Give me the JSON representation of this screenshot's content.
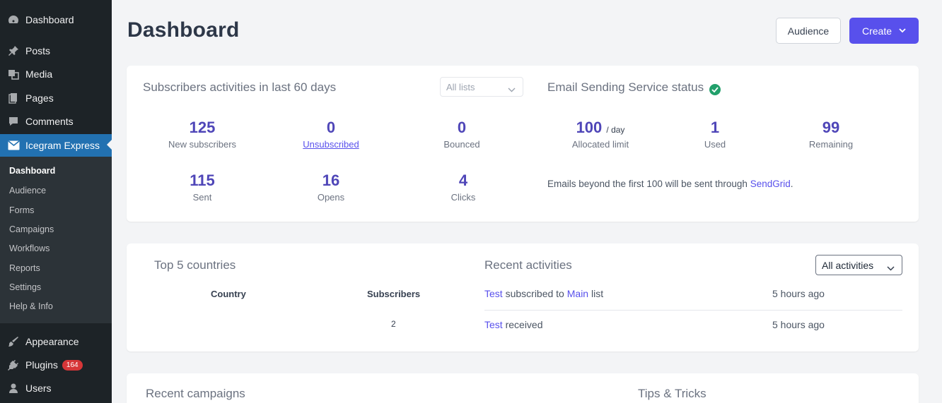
{
  "sidebar": {
    "items": [
      {
        "label": "Dashboard",
        "icon": "gauge-icon"
      },
      {
        "label": "Posts",
        "icon": "pin-icon"
      },
      {
        "label": "Media",
        "icon": "media-icon"
      },
      {
        "label": "Pages",
        "icon": "pages-icon"
      },
      {
        "label": "Comments",
        "icon": "comment-icon"
      },
      {
        "label": "Icegram Express",
        "icon": "envelope-icon"
      }
    ],
    "submenu": [
      "Dashboard",
      "Audience",
      "Forms",
      "Campaigns",
      "Workflows",
      "Reports",
      "Settings",
      "Help & Info"
    ],
    "bottom_items": [
      {
        "label": "Appearance",
        "icon": "brush-icon"
      },
      {
        "label": "Plugins",
        "icon": "plug-icon",
        "badge": "164"
      },
      {
        "label": "Users",
        "icon": "user-icon"
      }
    ]
  },
  "header": {
    "title": "Dashboard",
    "audience_label": "Audience",
    "create_label": "Create"
  },
  "subscribers": {
    "title": "Subscribers activities in last 60 days",
    "filter": "All lists",
    "stats": [
      {
        "value": "125",
        "label": "New subscribers"
      },
      {
        "value": "0",
        "label": "Unsubscribed"
      },
      {
        "value": "0",
        "label": "Bounced"
      },
      {
        "value": "115",
        "label": "Sent"
      },
      {
        "value": "16",
        "label": "Opens"
      },
      {
        "value": "4",
        "label": "Clicks"
      }
    ]
  },
  "email_service": {
    "title": "Email Sending Service status",
    "allocated": {
      "value": "100",
      "unit": "/ day",
      "label": "Allocated limit"
    },
    "used": {
      "value": "1",
      "label": "Used"
    },
    "remaining": {
      "value": "99",
      "label": "Remaining"
    },
    "note_prefix": "Emails beyond the first 100 will be sent through",
    "note_link": "SendGrid",
    "note_suffix": "."
  },
  "countries": {
    "title": "Top 5 countries",
    "col_country": "Country",
    "col_subscribers": "Subscribers",
    "rows": [
      {
        "country": "",
        "subscribers": "2"
      }
    ]
  },
  "activities": {
    "title": "Recent activities",
    "filter": "All activities",
    "rows": [
      {
        "link": "Test",
        "mid": "subscribed to",
        "link2": "Main",
        "end": "list",
        "time": "5 hours ago"
      },
      {
        "link": "Test",
        "mid": "received",
        "link2": "",
        "end": "",
        "time": "5 hours ago"
      }
    ]
  },
  "bottom": {
    "campaigns_title": "Recent campaigns",
    "tips_title": "Tips & Tricks"
  },
  "colors": {
    "accent": "#5850ec",
    "sidebar": "#1d2327",
    "active": "#2271b1",
    "success": "#22a06b"
  }
}
